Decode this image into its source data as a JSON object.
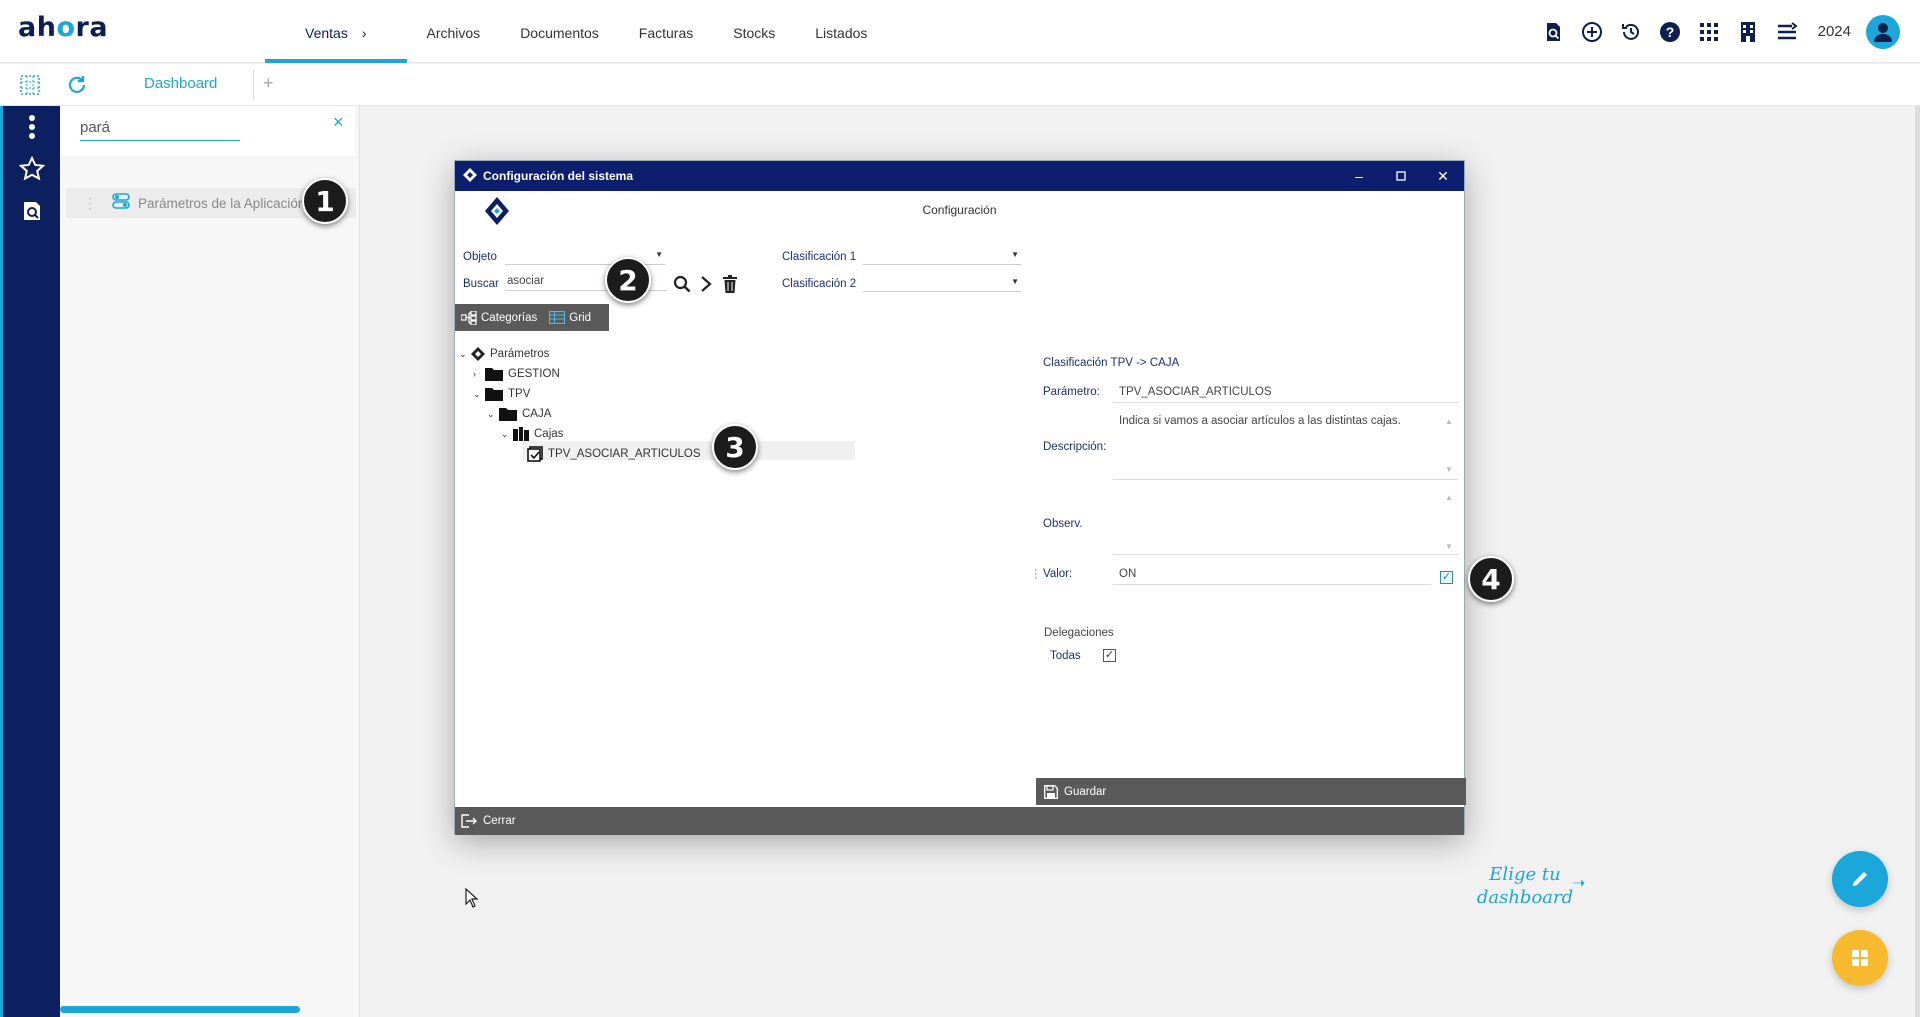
{
  "app": {
    "logo_text_a": "ah",
    "logo_text_b": "o",
    "logo_text_c": "ra",
    "year": "2024"
  },
  "nav": {
    "items": [
      {
        "label": "Ventas"
      },
      {
        "label": "Archivos"
      },
      {
        "label": "Documentos"
      },
      {
        "label": "Facturas"
      },
      {
        "label": "Stocks"
      },
      {
        "label": "Listados"
      }
    ]
  },
  "tabs": {
    "dashboard_label": "Dashboard",
    "add_label": "+"
  },
  "search": {
    "value": "pará",
    "clear_label": "×",
    "result_label": "Parámetros de la Aplicación"
  },
  "markers": [
    "1",
    "2",
    "3",
    "4"
  ],
  "dialog": {
    "title": "Configuración del sistema",
    "header": "Configuración",
    "objeto_label": "Objeto",
    "buscar_label": "Buscar",
    "buscar_value": "asociar",
    "clasif1_label": "Clasificación 1",
    "clasif2_label": "Clasificación 2",
    "categorias_label": "Categorías",
    "grid_label": "Grid",
    "tree": {
      "root": "Parámetros",
      "gestion": "GESTION",
      "tpv": "TPV",
      "caja": "CAJA",
      "cajas": "Cajas",
      "param": "TPV_ASOCIAR_ARTICULOS"
    },
    "detail": {
      "clasificacion": "Clasificación TPV -> CAJA",
      "parametro_label": "Parámetro:",
      "parametro_value": "TPV_ASOCIAR_ARTICULOS",
      "descripcion_label": "Descripción:",
      "descripcion_value": "Indica si vamos a asociar artículos a las distintas cajas.",
      "observ_label": "Observ.",
      "valor_label": "Valor:",
      "valor_value": "ON",
      "delegaciones_label": "Delegaciones",
      "todas_label": "Todas",
      "check_mark": "✓"
    },
    "guardar_label": "Guardar",
    "cerrar_label": "Cerrar"
  },
  "elige": {
    "line1": "Elige tu",
    "line2": "dashboard",
    "arrow": "➝"
  },
  "colors": {
    "accent": "#1ba7d9",
    "navy": "#0c1f5e",
    "fab_yellow": "#f7b92e"
  }
}
